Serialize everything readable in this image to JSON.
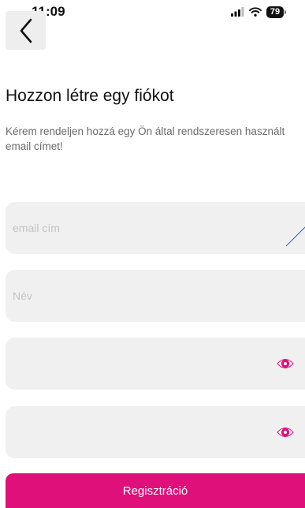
{
  "status_bar": {
    "time": "11:09",
    "battery_level": "79",
    "icons": [
      "signal-icon",
      "wifi-icon",
      "battery-icon"
    ]
  },
  "header": {
    "back_icon": "chevron-left-icon"
  },
  "content": {
    "title": "Hozzon létre egy fiókot",
    "subtitle": "Kérem rendeljen hozzá egy Ön által rendszeresen használt email címet!"
  },
  "form": {
    "email": {
      "value": "",
      "placeholder": "email cím"
    },
    "name": {
      "value": "",
      "placeholder": "Név"
    },
    "password": {
      "value": "",
      "placeholder": ""
    },
    "password_confirm": {
      "value": "",
      "placeholder": ""
    },
    "toggle_icon": "eye-icon"
  },
  "actions": {
    "register_label": "Regisztráció"
  },
  "colors": {
    "accent": "#e0107a",
    "field_background": "#f0f0f0",
    "back_button_background": "#eeeeee",
    "subtitle_text": "#6b6b6b",
    "placeholder_text": "#c4c4c4",
    "edit_mark": "#3b5bd6"
  }
}
